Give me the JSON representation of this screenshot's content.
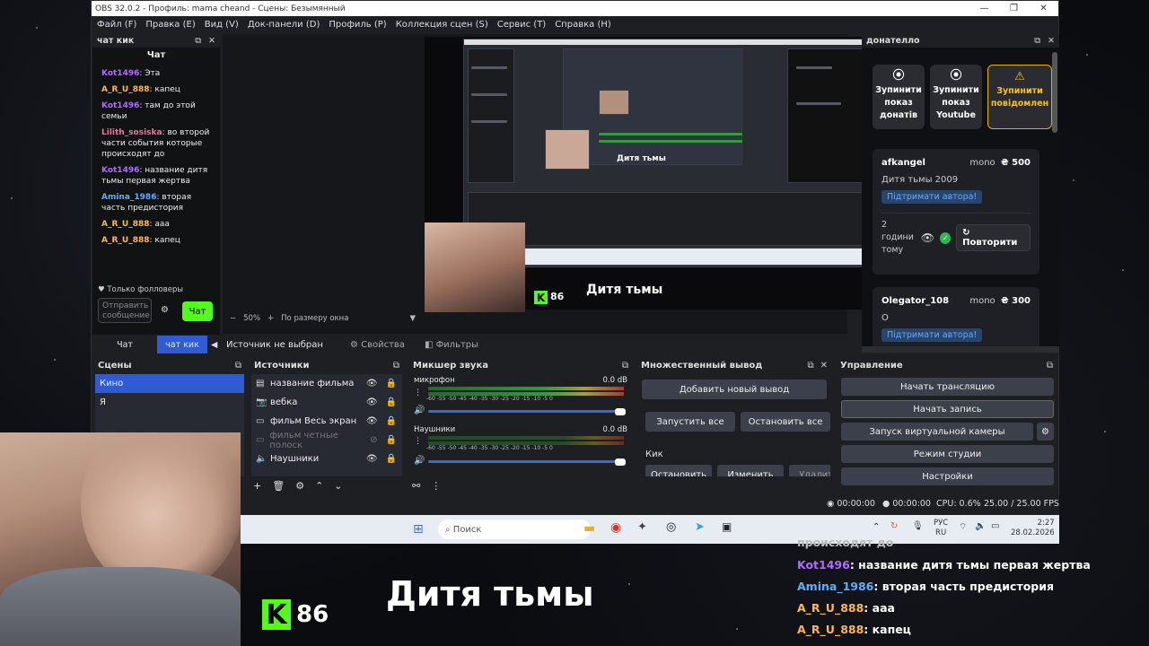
{
  "window": {
    "title": "OBS 32.0.2 - Профиль: mama cheand - Сцены: Безымянный",
    "controls": [
      "—",
      "❐",
      "✕"
    ]
  },
  "menu": [
    "Файл (F)",
    "Правка (E)",
    "Вид (V)",
    "Док-панели (D)",
    "Профиль (P)",
    "Коллекция сцен (S)",
    "Сервис (T)",
    "Справка (H)"
  ],
  "chat_dock": {
    "title": "чат кик",
    "header": "Чат",
    "messages": [
      {
        "user": "Kot1496",
        "text": ": Эта",
        "color": "purple"
      },
      {
        "user": "A_R_U_888",
        "text": ": капец",
        "color": "orange"
      },
      {
        "user": "Kot1496",
        "text": ": там до этой семьи",
        "color": "purple"
      },
      {
        "user": "Lilith_sosiska",
        "text": ": во второй части события которые происходят до",
        "color": "pink"
      },
      {
        "user": "Kot1496",
        "text": ": название дитя тьмы первая жертва",
        "color": "purple"
      },
      {
        "user": "Amina_1986",
        "text": ": вторая часть предистория",
        "color": "blue"
      },
      {
        "user": "A_R_U_888",
        "text": ": ааа",
        "color": "orange"
      },
      {
        "user": "A_R_U_888",
        "text": ": капец",
        "color": "orange"
      }
    ],
    "followers_only": "Только фолловеры",
    "input_placeholder": "Отправить сообщение",
    "send_label": "Чат",
    "tabs": [
      "Чат",
      "чат кик"
    ]
  },
  "preview": {
    "zoom": "50%",
    "fit_label": "По размеру окна",
    "overlay_title": "Дитя тьмы",
    "kick_count": "86"
  },
  "source_bar": {
    "no_source": "Источник не выбран",
    "properties": "Свойства",
    "filters": "Фильтры"
  },
  "donatello": {
    "title": "донателло",
    "buttons": [
      {
        "label": "Зупинити показ донатів",
        "icon": "stop-icon"
      },
      {
        "label": "Зупинити показ Youtube",
        "icon": "stop-icon"
      },
      {
        "label": "Зупинити повідомлен",
        "icon": "warning-icon"
      }
    ],
    "donations": [
      {
        "user": "afkangel",
        "method": "mono",
        "amount": "₴ 500",
        "message": "Дитя тьмы 2009",
        "support": "Підтримати автора!",
        "time": "2 години тому",
        "repeat": "Повторити"
      },
      {
        "user": "Olegator_108",
        "method": "mono",
        "amount": "₴ 300",
        "message": "О",
        "support": "Підтримати автора!"
      }
    ]
  },
  "scenes": {
    "title": "Сцены",
    "items": [
      "Кино",
      "Я"
    ]
  },
  "sources": {
    "title": "Источники",
    "items": [
      {
        "name": "название фильма",
        "icon": "text-icon",
        "visible": true
      },
      {
        "name": "вебка",
        "icon": "camera-icon",
        "visible": true
      },
      {
        "name": "фильм Весь экран",
        "icon": "monitor-icon",
        "visible": true
      },
      {
        "name": "фильм четные полоск",
        "icon": "monitor-icon",
        "visible": false
      },
      {
        "name": "Наушники",
        "icon": "speaker-icon",
        "visible": true
      }
    ]
  },
  "mixer": {
    "title": "Микшер звука",
    "channels": [
      {
        "name": "микрофон",
        "db": "0.0 dB"
      },
      {
        "name": "Наушники",
        "db": "0.0 dB"
      }
    ],
    "ticks": [
      "-60",
      "-55",
      "-50",
      "-45",
      "-40",
      "-35",
      "-30",
      "-25",
      "-20",
      "-15",
      "-10",
      "-5",
      "0"
    ]
  },
  "multi_output": {
    "title": "Множественный вывод",
    "add_new": "Добавить новый вывод",
    "start_all": "Запустить все",
    "stop_all": "Остановить все",
    "target": "Кик",
    "stop": "Остановить",
    "edit": "Изменить",
    "delete": "Удалит"
  },
  "controls": {
    "title": "Управление",
    "start_stream": "Начать трансляцию",
    "start_record": "Начать запись",
    "virtual_cam": "Запуск виртуальной камеры",
    "studio_mode": "Режим студии",
    "settings": "Настройки"
  },
  "status": {
    "stream_time": "00:00:00",
    "record_time": "00:00:00",
    "cpu": "CPU: 0.6%",
    "fps": "25.00 / 25.00 FPS"
  },
  "taskbar": {
    "search": "Поиск",
    "lang": "РУС",
    "region": "RU",
    "time": "2:27",
    "date": "28.02.2026"
  },
  "stream_overlay": {
    "title": "Дитя тьмы",
    "kick_count": "86",
    "chat_partial": "происходят до",
    "chat": [
      {
        "user": "Kot1496",
        "text": ": название дитя тьмы первая жертва",
        "color": "#b06bff"
      },
      {
        "user": "Amina_1986",
        "text": ": вторая часть предистория",
        "color": "#5ab0ff"
      },
      {
        "user": "A_R_U_888",
        "text": ": ааа",
        "color": "#ffb84a"
      },
      {
        "user": "A_R_U_888",
        "text": ": капец",
        "color": "#ffb84a"
      }
    ]
  },
  "colors": {
    "accent_blue": "#2f5bd3",
    "kick_green": "#53fc18",
    "panel": "#272a33"
  }
}
